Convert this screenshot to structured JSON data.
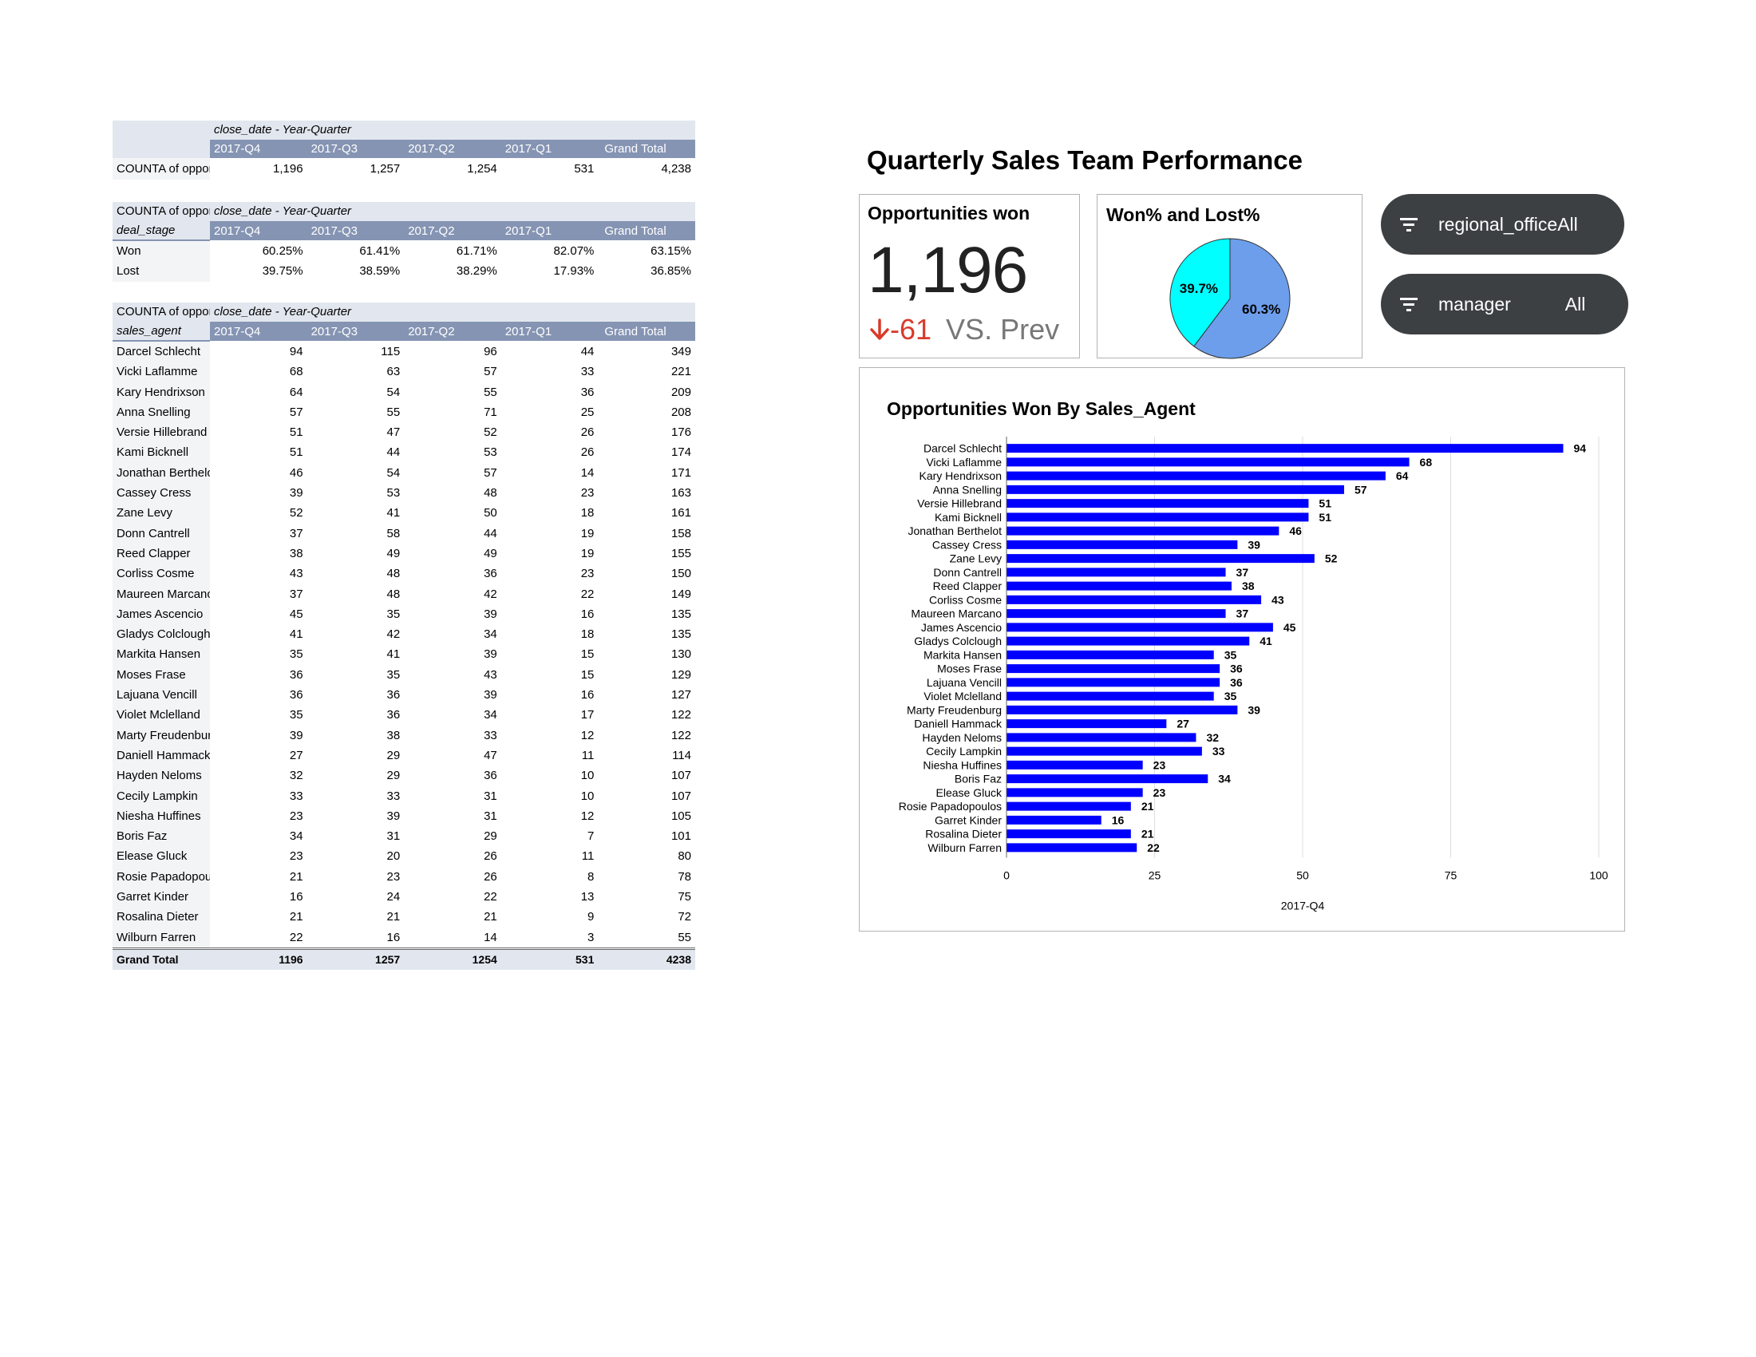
{
  "table1": {
    "meta_label": "close_date - Year-Quarter",
    "columns": [
      "2017-Q4",
      "2017-Q3",
      "2017-Q2",
      "2017-Q1",
      "Grand Total"
    ],
    "row": {
      "label": "COUNTA of opportunity_id",
      "values": [
        "1,196",
        "1,257",
        "1,254",
        "531",
        "4,238"
      ]
    }
  },
  "table2": {
    "measure_label": "COUNTA of opportunity_id",
    "meta_label": "close_date - Year-Quarter",
    "row_dim": "deal_stage",
    "columns": [
      "2017-Q4",
      "2017-Q3",
      "2017-Q2",
      "2017-Q1",
      "Grand Total"
    ],
    "rows": [
      {
        "label": "Won",
        "values": [
          "60.25%",
          "61.41%",
          "61.71%",
          "82.07%",
          "63.15%"
        ]
      },
      {
        "label": "Lost",
        "values": [
          "39.75%",
          "38.59%",
          "38.29%",
          "17.93%",
          "36.85%"
        ]
      }
    ]
  },
  "table3": {
    "measure_label": "COUNTA of opportunity_id",
    "meta_label": "close_date - Year-Quarter",
    "row_dim": "sales_agent",
    "columns": [
      "2017-Q4",
      "2017-Q3",
      "2017-Q2",
      "2017-Q1",
      "Grand Total"
    ],
    "rows": [
      {
        "label": "Darcel Schlecht",
        "values": [
          "94",
          "115",
          "96",
          "44",
          "349"
        ]
      },
      {
        "label": "Vicki Laflamme",
        "values": [
          "68",
          "63",
          "57",
          "33",
          "221"
        ]
      },
      {
        "label": "Kary Hendrixson",
        "values": [
          "64",
          "54",
          "55",
          "36",
          "209"
        ]
      },
      {
        "label": "Anna Snelling",
        "values": [
          "57",
          "55",
          "71",
          "25",
          "208"
        ]
      },
      {
        "label": "Versie Hillebrand",
        "values": [
          "51",
          "47",
          "52",
          "26",
          "176"
        ]
      },
      {
        "label": "Kami Bicknell",
        "values": [
          "51",
          "44",
          "53",
          "26",
          "174"
        ]
      },
      {
        "label": "Jonathan Berthelot",
        "values": [
          "46",
          "54",
          "57",
          "14",
          "171"
        ]
      },
      {
        "label": "Cassey Cress",
        "values": [
          "39",
          "53",
          "48",
          "23",
          "163"
        ]
      },
      {
        "label": "Zane Levy",
        "values": [
          "52",
          "41",
          "50",
          "18",
          "161"
        ]
      },
      {
        "label": "Donn Cantrell",
        "values": [
          "37",
          "58",
          "44",
          "19",
          "158"
        ]
      },
      {
        "label": "Reed Clapper",
        "values": [
          "38",
          "49",
          "49",
          "19",
          "155"
        ]
      },
      {
        "label": "Corliss Cosme",
        "values": [
          "43",
          "48",
          "36",
          "23",
          "150"
        ]
      },
      {
        "label": "Maureen Marcano",
        "values": [
          "37",
          "48",
          "42",
          "22",
          "149"
        ]
      },
      {
        "label": "James Ascencio",
        "values": [
          "45",
          "35",
          "39",
          "16",
          "135"
        ]
      },
      {
        "label": "Gladys Colclough",
        "values": [
          "41",
          "42",
          "34",
          "18",
          "135"
        ]
      },
      {
        "label": "Markita Hansen",
        "values": [
          "35",
          "41",
          "39",
          "15",
          "130"
        ]
      },
      {
        "label": "Moses Frase",
        "values": [
          "36",
          "35",
          "43",
          "15",
          "129"
        ]
      },
      {
        "label": "Lajuana Vencill",
        "values": [
          "36",
          "36",
          "39",
          "16",
          "127"
        ]
      },
      {
        "label": "Violet Mclelland",
        "values": [
          "35",
          "36",
          "34",
          "17",
          "122"
        ]
      },
      {
        "label": "Marty Freudenburg",
        "values": [
          "39",
          "38",
          "33",
          "12",
          "122"
        ]
      },
      {
        "label": "Daniell Hammack",
        "values": [
          "27",
          "29",
          "47",
          "11",
          "114"
        ]
      },
      {
        "label": "Hayden Neloms",
        "values": [
          "32",
          "29",
          "36",
          "10",
          "107"
        ]
      },
      {
        "label": "Cecily Lampkin",
        "values": [
          "33",
          "33",
          "31",
          "10",
          "107"
        ]
      },
      {
        "label": "Niesha Huffines",
        "values": [
          "23",
          "39",
          "31",
          "12",
          "105"
        ]
      },
      {
        "label": "Boris Faz",
        "values": [
          "34",
          "31",
          "29",
          "7",
          "101"
        ]
      },
      {
        "label": "Elease Gluck",
        "values": [
          "23",
          "20",
          "26",
          "11",
          "80"
        ]
      },
      {
        "label": "Rosie Papadopoulos",
        "values": [
          "21",
          "23",
          "26",
          "8",
          "78"
        ]
      },
      {
        "label": "Garret Kinder",
        "values": [
          "16",
          "24",
          "22",
          "13",
          "75"
        ]
      },
      {
        "label": "Rosalina Dieter",
        "values": [
          "21",
          "21",
          "21",
          "9",
          "72"
        ]
      },
      {
        "label": "Wilburn Farren",
        "values": [
          "22",
          "16",
          "14",
          "3",
          "55"
        ]
      }
    ],
    "total": {
      "label": "Grand Total",
      "values": [
        "1196",
        "1257",
        "1254",
        "531",
        "4238"
      ]
    }
  },
  "dashboard": {
    "title": "Quarterly Sales Team Performance",
    "kpi": {
      "title": "Opportunities won",
      "value": "1,196",
      "delta": "-61",
      "delta_suffix": "VS. Prev",
      "delta_icon": "arrow-down-icon",
      "delta_color": "#d93a2b"
    },
    "pie": {
      "title": "Won% and Lost%",
      "slices": [
        {
          "label": "60.3%",
          "value": 60.3,
          "color": "#6d9eeb"
        },
        {
          "label": "39.7%",
          "value": 39.7,
          "color": "#00ffff"
        }
      ]
    },
    "filters": [
      {
        "name": "regional_office",
        "value": "All",
        "icon": "filter-icon"
      },
      {
        "name": "manager",
        "value": "All",
        "icon": "filter-icon"
      }
    ]
  },
  "chart_data": {
    "type": "bar",
    "orientation": "horizontal",
    "title": "Opportunities Won By Sales_Agent",
    "xlabel": "2017-Q4",
    "ylabel": "",
    "xlim": [
      0,
      100
    ],
    "xticks": [
      0,
      25,
      50,
      75,
      100
    ],
    "grid": true,
    "bar_color": "#0000ff",
    "categories": [
      "Darcel Schlecht",
      "Vicki Laflamme",
      "Kary Hendrixson",
      "Anna Snelling",
      "Versie Hillebrand",
      "Kami Bicknell",
      "Jonathan Berthelot",
      "Cassey Cress",
      "Zane Levy",
      "Donn Cantrell",
      "Reed Clapper",
      "Corliss Cosme",
      "Maureen Marcano",
      "James Ascencio",
      "Gladys Colclough",
      "Markita Hansen",
      "Moses Frase",
      "Lajuana Vencill",
      "Violet Mclelland",
      "Marty Freudenburg",
      "Daniell Hammack",
      "Hayden Neloms",
      "Cecily Lampkin",
      "Niesha Huffines",
      "Boris Faz",
      "Elease Gluck",
      "Rosie Papadopoulos",
      "Garret Kinder",
      "Rosalina Dieter",
      "Wilburn Farren"
    ],
    "values": [
      94,
      68,
      64,
      57,
      51,
      51,
      46,
      39,
      52,
      37,
      38,
      43,
      37,
      45,
      41,
      35,
      36,
      36,
      35,
      39,
      27,
      32,
      33,
      23,
      34,
      23,
      21,
      16,
      21,
      22
    ]
  }
}
